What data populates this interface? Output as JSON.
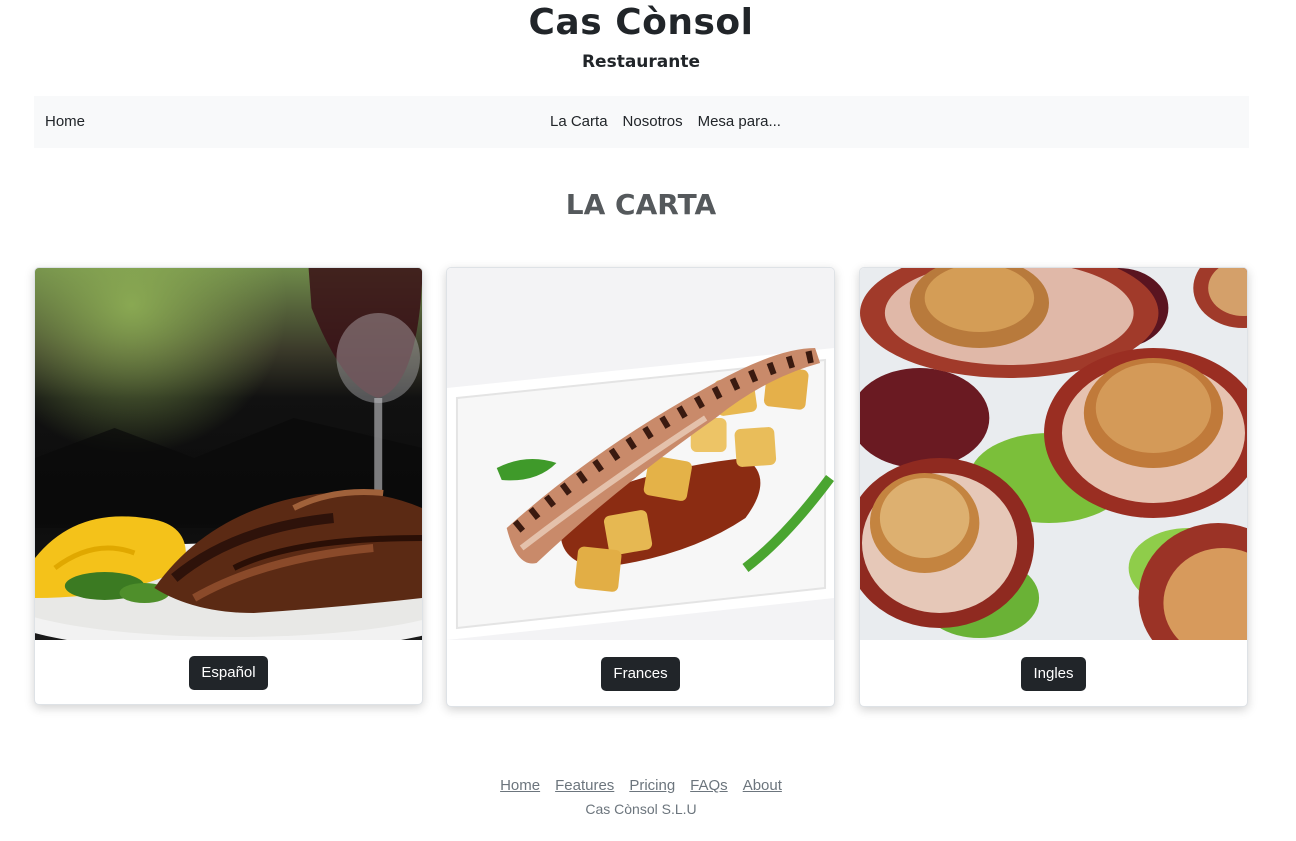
{
  "header": {
    "title": "Cas Cònsol",
    "subtitle": "Restaurante"
  },
  "nav": {
    "home": "Home",
    "links": [
      "La Carta",
      "Nosotros",
      "Mesa para..."
    ]
  },
  "main": {
    "section_title": "LA CARTA",
    "cards": [
      {
        "button_label": "Español",
        "image": "grilled-meat-dish-photo"
      },
      {
        "button_label": "Frances",
        "image": "grilled-octopus-dish-photo"
      },
      {
        "button_label": "Ingles",
        "image": "scallops-dish-photo"
      }
    ]
  },
  "footer": {
    "links": [
      "Home",
      "Features",
      "Pricing",
      "FAQs",
      "About"
    ],
    "copyright": "Cas Cònsol S.L.U"
  }
}
